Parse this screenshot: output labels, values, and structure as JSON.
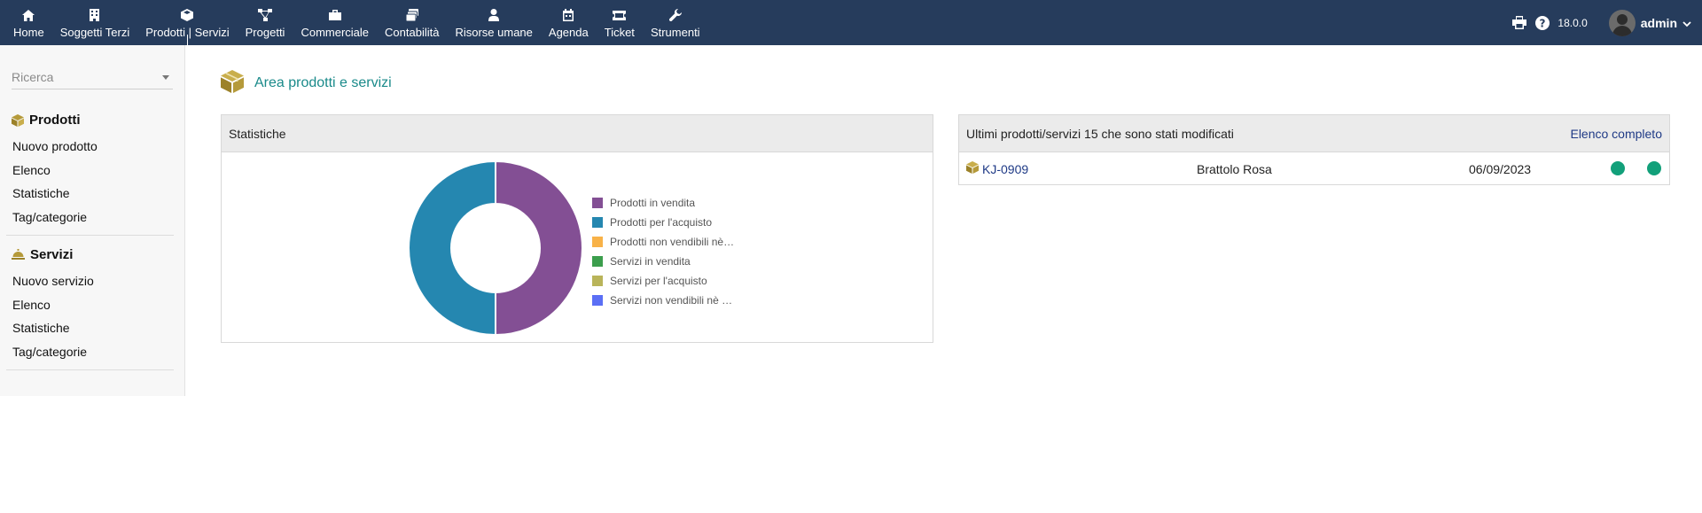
{
  "topbar": {
    "nav": [
      {
        "label": "Home",
        "icon": "home-icon"
      },
      {
        "label": "Soggetti Terzi",
        "icon": "building-icon"
      },
      {
        "label": "Prodotti | Servizi",
        "icon": "box-icon"
      },
      {
        "label": "Progetti",
        "icon": "sitemap-icon"
      },
      {
        "label": "Commerciale",
        "icon": "briefcase-icon"
      },
      {
        "label": "Contabilità",
        "icon": "money-icon"
      },
      {
        "label": "Risorse umane",
        "icon": "user-tie-icon"
      },
      {
        "label": "Agenda",
        "icon": "calendar-icon"
      },
      {
        "label": "Ticket",
        "icon": "ticket-icon"
      },
      {
        "label": "Strumenti",
        "icon": "wrench-icon"
      }
    ],
    "version": "18.0.0",
    "user": "admin"
  },
  "sidebar": {
    "search_placeholder": "Ricerca",
    "products": {
      "title": "Prodotti",
      "links": [
        "Nuovo prodotto",
        "Elenco",
        "Statistiche",
        "Tag/categorie"
      ]
    },
    "services": {
      "title": "Servizi",
      "links": [
        "Nuovo servizio",
        "Elenco",
        "Statistiche",
        "Tag/categorie"
      ]
    }
  },
  "main": {
    "title": "Area prodotti e servizi",
    "stats_panel": {
      "title": "Statistiche",
      "legend": [
        {
          "label": "Prodotti in vendita",
          "color": "#834f94"
        },
        {
          "label": "Prodotti per l'acquisto",
          "color": "#2587b0"
        },
        {
          "label": "Prodotti non vendibili nè…",
          "color": "#f8b248"
        },
        {
          "label": "Servizi in vendita",
          "color": "#3c9e4d"
        },
        {
          "label": "Servizi per l'acquisto",
          "color": "#b9b45a"
        },
        {
          "label": "Servizi non vendibili nè …",
          "color": "#5b6ff5"
        }
      ]
    },
    "latest_panel": {
      "title": "Ultimi prodotti/servizi 15 che sono stati modificati",
      "link": "Elenco completo",
      "rows": [
        {
          "ref": "KJ-0909",
          "label": "Brattolo Rosa",
          "date": "06/09/2023"
        }
      ]
    }
  },
  "chart_data": {
    "type": "pie",
    "categories": [
      "Prodotti in vendita",
      "Prodotti per l'acquisto",
      "Prodotti non vendibili nè…",
      "Servizi in vendita",
      "Servizi per l'acquisto",
      "Servizi non vendibili nè …"
    ],
    "values": [
      1,
      1,
      0,
      0,
      0,
      0
    ],
    "colors": [
      "#834f94",
      "#2587b0",
      "#f8b248",
      "#3c9e4d",
      "#b9b45a",
      "#5b6ff5"
    ],
    "donut": true,
    "legend": "right"
  }
}
